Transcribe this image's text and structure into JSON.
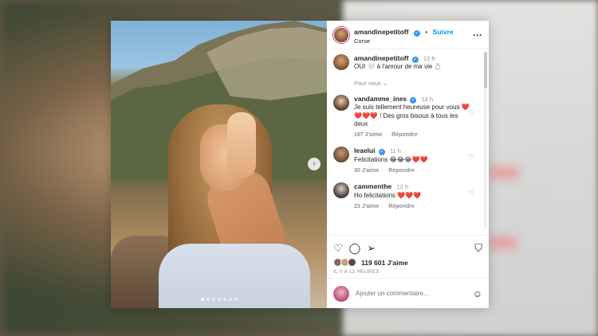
{
  "post": {
    "author": "amandinepetitoff",
    "follow_label": "Suivre",
    "location": "Corse",
    "more_label": "···",
    "caption": {
      "author": "amandinepetitoff",
      "time": "12 h",
      "text": "OUI 🤍 à l'amour de ma vie 💍"
    },
    "for_you_label": "Pour vous ⌄",
    "comments": [
      {
        "author": "vandamme_ines",
        "time": "12 h",
        "text": "Je suis tellement heureuse pour vous ❤️❤️❤️❤️ ! Des gros bisous à tous les deux",
        "likes": "197 J'aime",
        "reply": "Répondre"
      },
      {
        "author": "leaelui",
        "time": "11 h",
        "text": "Felicitations 😂😂😂❤️❤️",
        "likes": "30 J'aime",
        "reply": "Répondre"
      },
      {
        "author": "cammenthe",
        "time": "12 h",
        "text": "Ho felicitations ❤️❤️❤️",
        "likes": "23 J'aime",
        "reply": "Répondre"
      }
    ],
    "like_count": "119 601 J'aime",
    "posted_ago": "IL Y A 12 HEURES",
    "comment_placeholder": "Ajouter un commentaire...",
    "carousel": {
      "slide_count": 7,
      "active_slide": 1
    },
    "icons": {
      "like": "heart-icon",
      "comment": "comment-icon",
      "share": "share-icon",
      "save": "bookmark-icon",
      "emoji": "emoji-icon",
      "next": "chevron-right-icon"
    },
    "colors": {
      "follow_blue": "#0095f6",
      "verified_blue": "#3897f0",
      "text": "#262626",
      "secondary": "#8e8e8e"
    }
  }
}
